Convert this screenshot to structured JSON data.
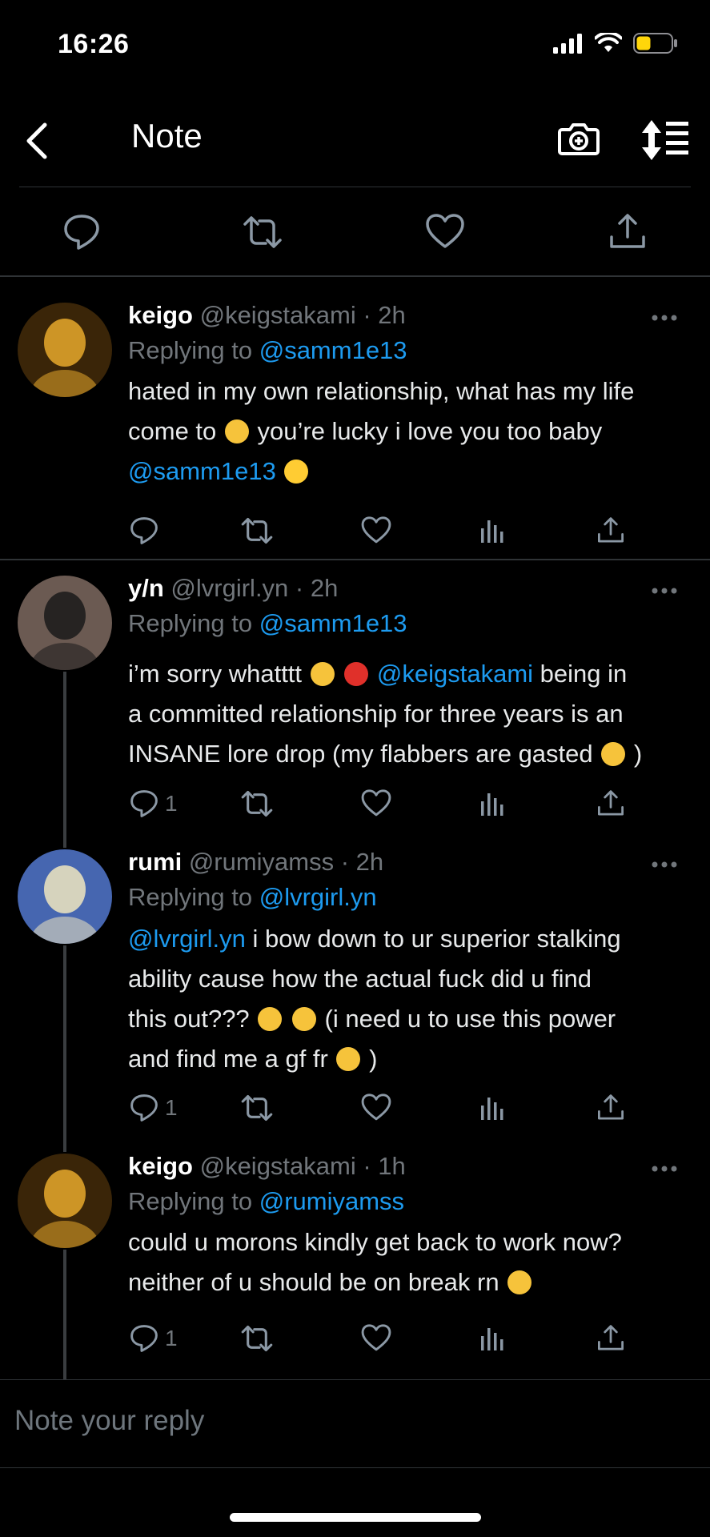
{
  "status_bar": {
    "time": "16:26",
    "battery_color": "#ffd60a"
  },
  "nav": {
    "title": "Note"
  },
  "reply_bar": {
    "placeholder": "Note your reply"
  },
  "tweets": [
    {
      "name": "keigo",
      "handle": "@keigstakami · 2h",
      "replying_label": "Replying to ",
      "replying_handle": "@samm1e13",
      "lines": [
        [
          {
            "t": "hated in my own relationship, what has my life"
          }
        ],
        [
          {
            "t": "come to "
          },
          {
            "emoji": "sleepy-face",
            "color": "#f6c33b"
          },
          {
            "t": " you’re lucky i love you too baby"
          }
        ],
        [
          {
            "t": "@samm1e13",
            "blue": true
          },
          {
            "t": " "
          },
          {
            "emoji": "yellow-heart",
            "color": "#ffcc33"
          }
        ]
      ],
      "reply_count": ""
    },
    {
      "name": "y/n",
      "handle": "@lvrgirl.yn · 2h",
      "replying_label": "Replying to ",
      "replying_handle": "@samm1e13",
      "lines": [
        [
          {
            "t": "i’m sorry whatttt "
          },
          {
            "emoji": "flushed-face",
            "color": "#f6c33b"
          },
          {
            "t": " "
          },
          {
            "emoji": "double-exclamation",
            "color": "#e0302a"
          },
          {
            "t": " "
          },
          {
            "t": "@keigstakami",
            "blue": true
          },
          {
            "t": " being in"
          }
        ],
        [
          {
            "t": "a committed relationship for three years is an"
          }
        ],
        [
          {
            "t": "INSANE lore drop (my flabbers are gasted "
          },
          {
            "emoji": "worried-face",
            "color": "#f6c33b"
          },
          {
            "t": " )"
          }
        ]
      ],
      "reply_count": "1"
    },
    {
      "name": "rumi",
      "handle": "@rumiyamss · 2h",
      "replying_label": "Replying to ",
      "replying_handle": "@lvrgirl.yn",
      "lines": [
        [
          {
            "t": "@lvrgirl.yn",
            "blue": true
          },
          {
            "t": " i bow down to ur superior stalking"
          }
        ],
        [
          {
            "t": "ability cause how the actual fuck did u find"
          }
        ],
        [
          {
            "t": "this out??? "
          },
          {
            "emoji": "flushed-face",
            "color": "#f6c33b"
          },
          {
            "t": " "
          },
          {
            "emoji": "flushed-face",
            "color": "#f6c33b"
          },
          {
            "t": " (i need u to use this power"
          }
        ],
        [
          {
            "t": "and find me a gf fr "
          },
          {
            "emoji": "weary-face",
            "color": "#f6c33b"
          },
          {
            "t": " )"
          }
        ]
      ],
      "reply_count": "1"
    },
    {
      "name": "keigo",
      "handle": "@keigstakami · 1h",
      "replying_label": "Replying to ",
      "replying_handle": "@rumiyamss",
      "lines": [
        [
          {
            "t": "could u morons kindly get back to work now?"
          }
        ],
        [
          {
            "t": "neither of u should be on break rn "
          },
          {
            "emoji": "raised-eyebrow-face",
            "color": "#f6c33b"
          }
        ]
      ],
      "reply_count": "1"
    }
  ]
}
